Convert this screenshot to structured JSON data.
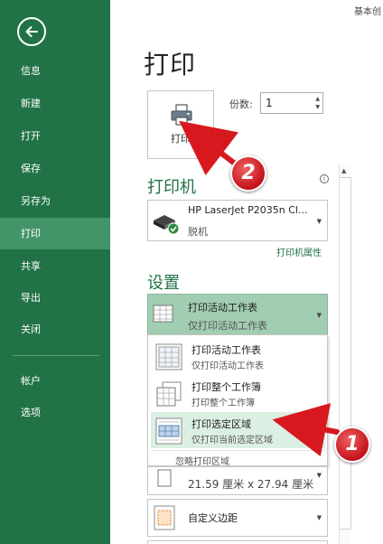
{
  "window": {
    "top_text": "基本创"
  },
  "sidebar": {
    "items": [
      {
        "label": "信息"
      },
      {
        "label": "新建"
      },
      {
        "label": "打开"
      },
      {
        "label": "保存"
      },
      {
        "label": "另存为"
      },
      {
        "label": "打印"
      },
      {
        "label": "共享"
      },
      {
        "label": "导出"
      },
      {
        "label": "关闭"
      },
      {
        "label": "帐户"
      },
      {
        "label": "选项"
      }
    ],
    "active": "打印",
    "colors": {
      "background": "#217346",
      "active": "#439467"
    }
  },
  "main": {
    "title": "打印",
    "print_button_label": "打印",
    "copies_label": "份数:",
    "copies_value": "1",
    "printer_section": {
      "title": "打印机",
      "printer_name": "HP LaserJet P2035n Cl...",
      "printer_status": "脱机",
      "properties_link": "打印机属性"
    },
    "settings_section": {
      "title": "设置",
      "selected": {
        "title": "打印活动工作表",
        "subtitle": "仅打印活动工作表"
      },
      "menu": {
        "items": [
          {
            "title": "打印活动工作表",
            "subtitle": "仅打印活动工作表"
          },
          {
            "title": "打印整个工作簿",
            "subtitle": "打印整个工作簿"
          },
          {
            "title": "打印选定区域",
            "subtitle": "仅打印当前选定区域",
            "highlighted": true
          }
        ],
        "footer": "忽略打印区域"
      },
      "paper_size": "21.59 厘米 x 27.94 厘米",
      "custom_margins": "自定义边距"
    }
  },
  "annotations": [
    {
      "number": "1",
      "color": "#d7191f"
    },
    {
      "number": "2",
      "color": "#d7191f"
    }
  ]
}
